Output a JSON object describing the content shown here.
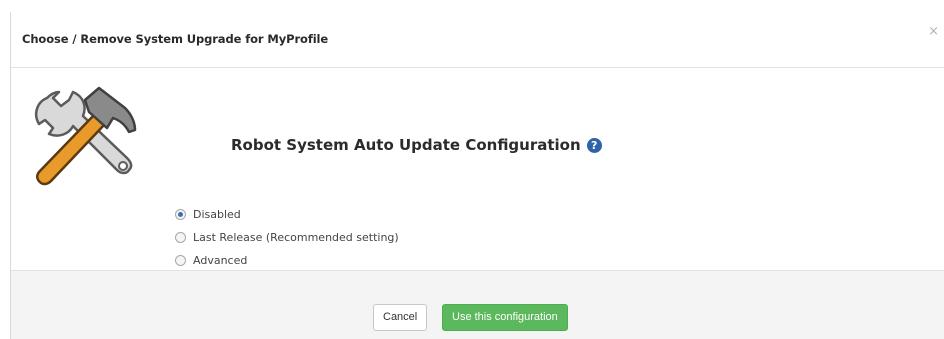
{
  "dialog": {
    "title": "Choose / Remove System Upgrade for MyProfile",
    "close_label": "×",
    "heading": "Robot System Auto Update Configuration",
    "help_icon_label": "?",
    "icon": "tools-icon",
    "options": [
      {
        "label": "Disabled",
        "checked": true
      },
      {
        "label": "Last Release (Recommended setting)",
        "checked": false
      },
      {
        "label": "Advanced",
        "checked": false
      }
    ]
  },
  "footer": {
    "cancel_label": "Cancel",
    "apply_label": "Use this configuration"
  },
  "colors": {
    "primary_button": "#5cb85c",
    "help_icon": "#2f63a8",
    "footer_bg": "#f4f4f4"
  }
}
